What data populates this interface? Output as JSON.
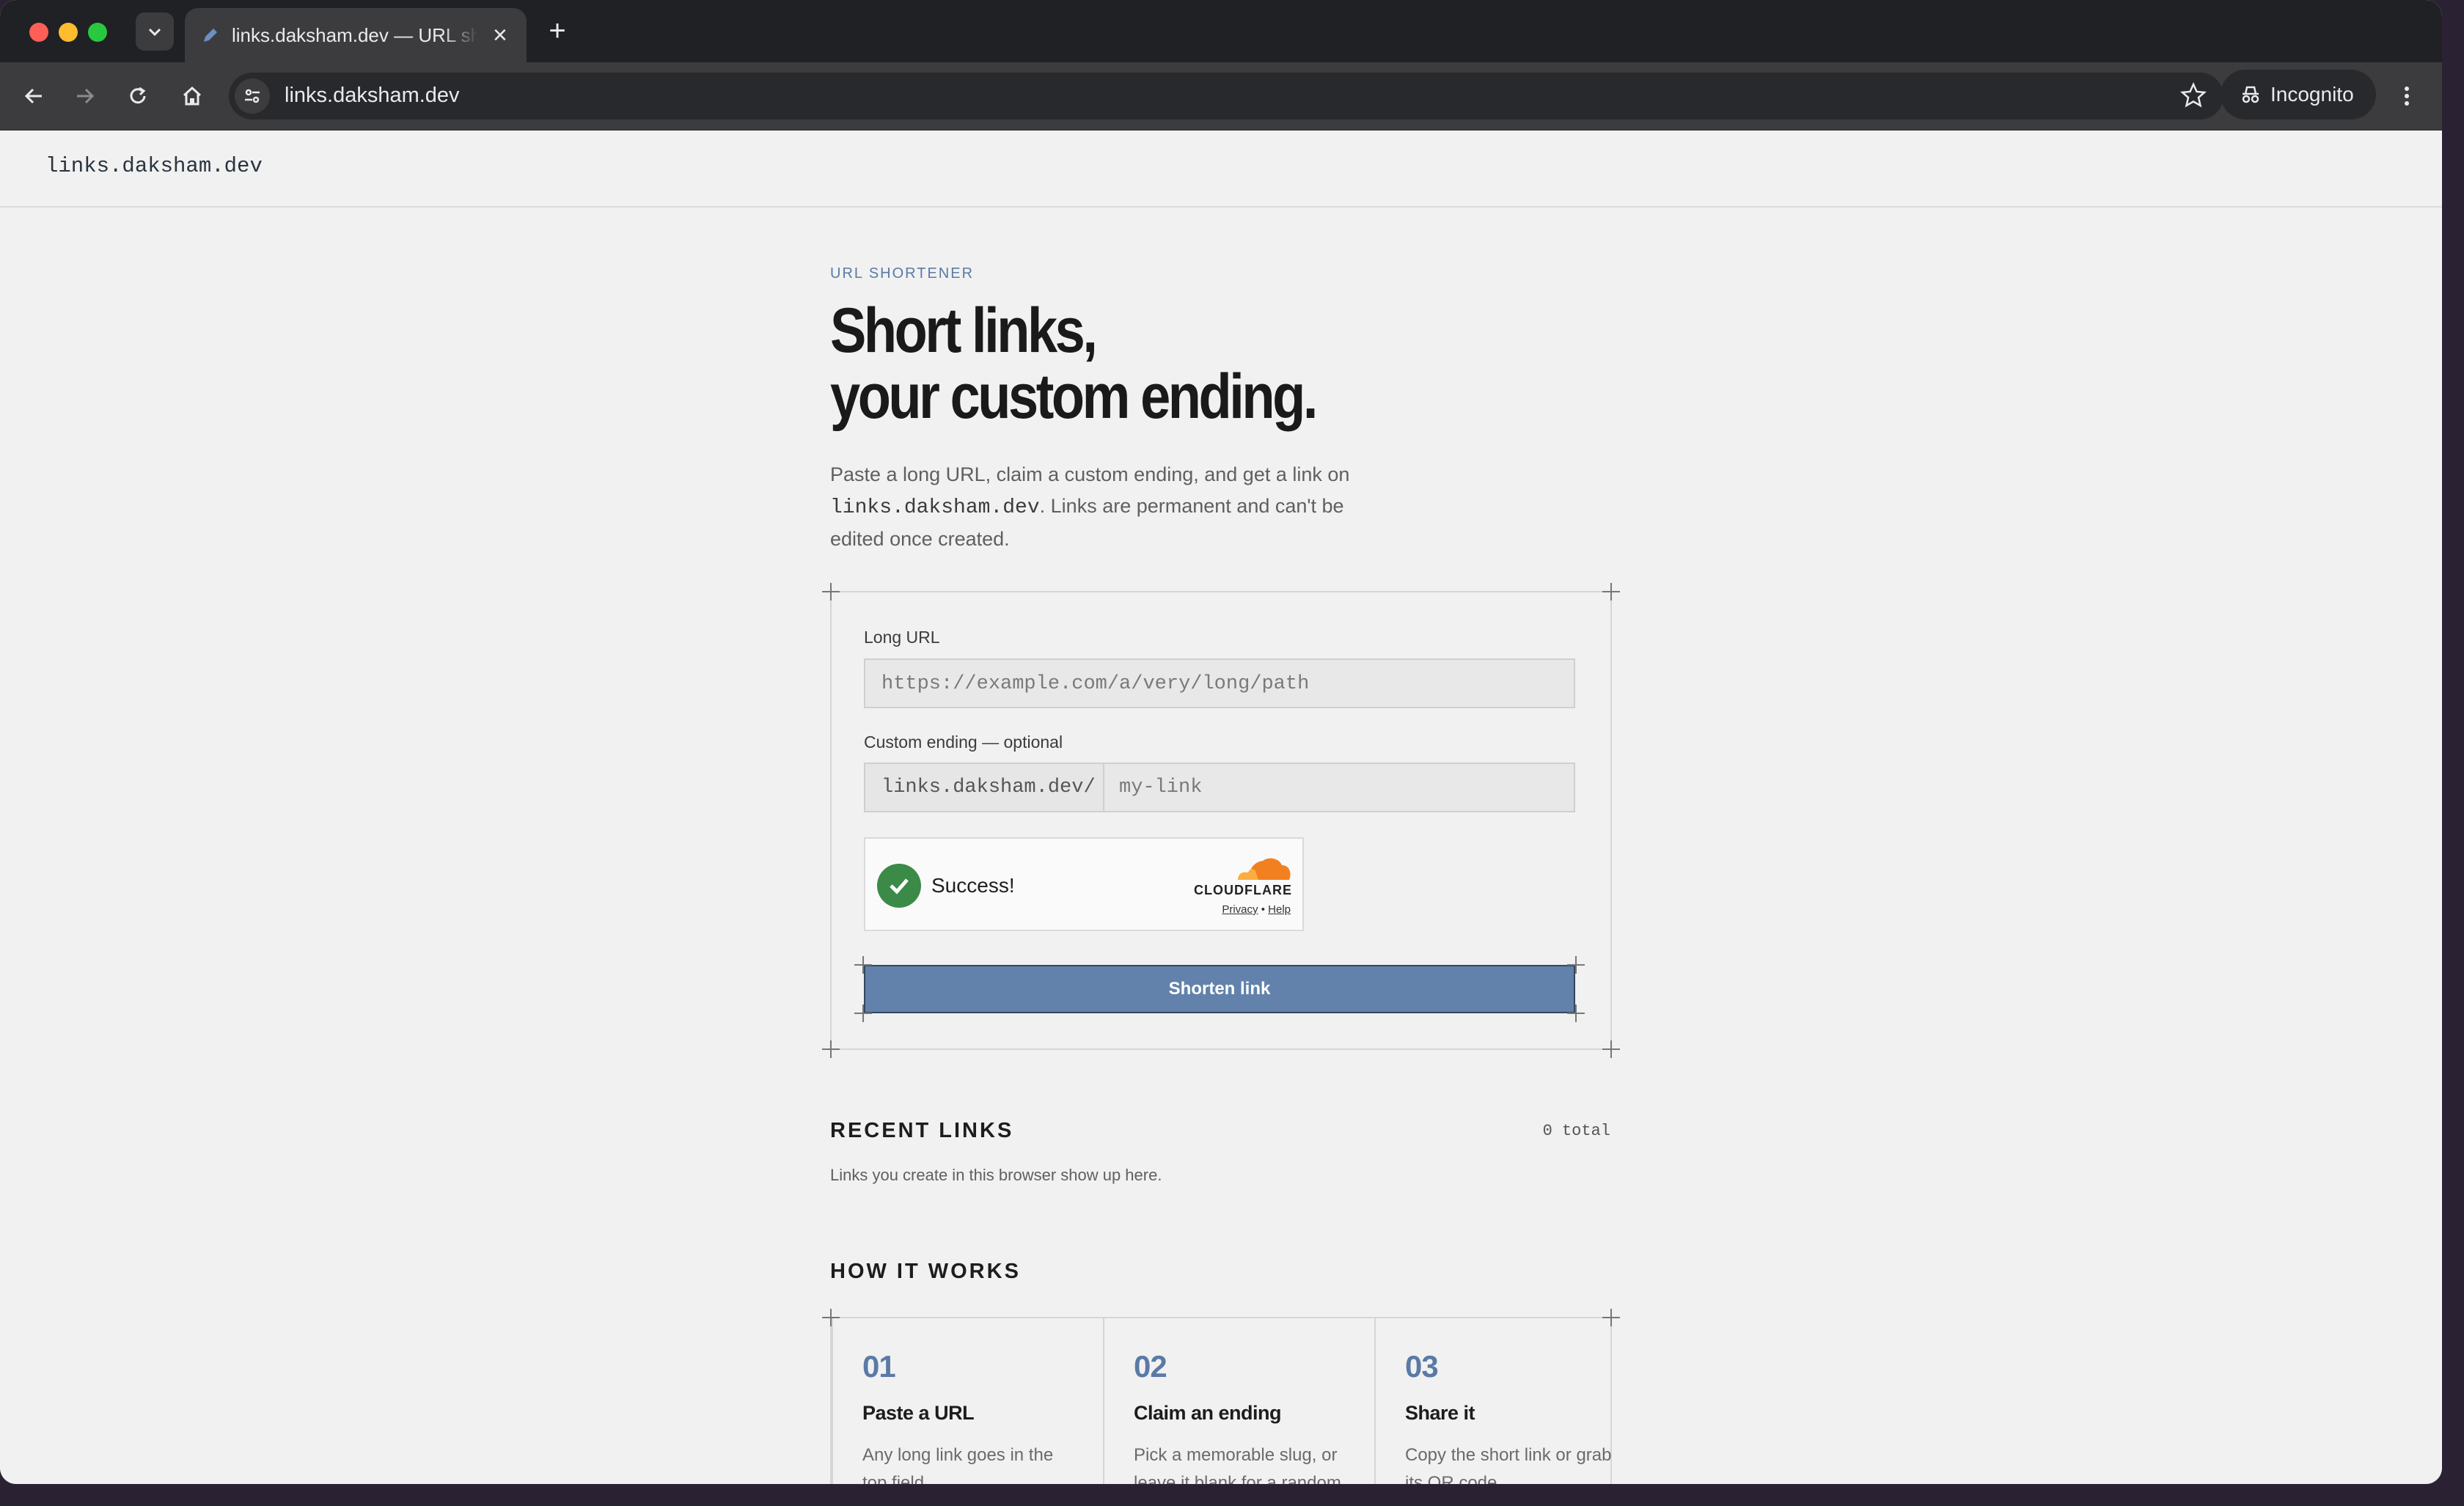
{
  "browser": {
    "tab_title": "links.daksham.dev — URL shortener",
    "new_tab_symbol": "+",
    "close_symbol": "×",
    "address": "links.daksham.dev",
    "incognito_label": "Incognito"
  },
  "site": {
    "brand": "links.daksham.dev"
  },
  "hero": {
    "eyebrow": "URL SHORTENER",
    "headline_line1": "Short links,",
    "headline_line2": "your custom ending.",
    "intro_part1": "Paste a long URL, claim a custom ending, and get a link on ",
    "intro_domain": "links.daksham.dev",
    "intro_part2": ". Links are permanent and can't be edited once created."
  },
  "form": {
    "long_url_label": "Long URL",
    "long_url_placeholder": "https://example.com/a/very/long/path",
    "custom_label": "Custom ending — optional",
    "custom_prefix": "links.daksham.dev/",
    "custom_placeholder": "my-link",
    "turnstile_status": "Success!",
    "turnstile_brand": "CLOUDFLARE",
    "turnstile_privacy": "Privacy",
    "turnstile_sep": "•",
    "turnstile_help": "Help",
    "submit_label": "Shorten link"
  },
  "recent": {
    "title": "RECENT LINKS",
    "count": "0 total",
    "empty_text": "Links you create in this browser show up here."
  },
  "how": {
    "title": "HOW IT WORKS",
    "steps": [
      {
        "num": "01",
        "title": "Paste a URL",
        "desc": "Any long link goes in the top field."
      },
      {
        "num": "02",
        "title": "Claim an ending",
        "desc": "Pick a memorable slug, or leave it blank for a random one."
      },
      {
        "num": "03",
        "title": "Share it",
        "desc": "Copy the short link or grab its QR code."
      }
    ]
  },
  "colors": {
    "accent": "#6282ab",
    "eyebrow": "#5a7aa6",
    "success": "#3b8a47"
  }
}
